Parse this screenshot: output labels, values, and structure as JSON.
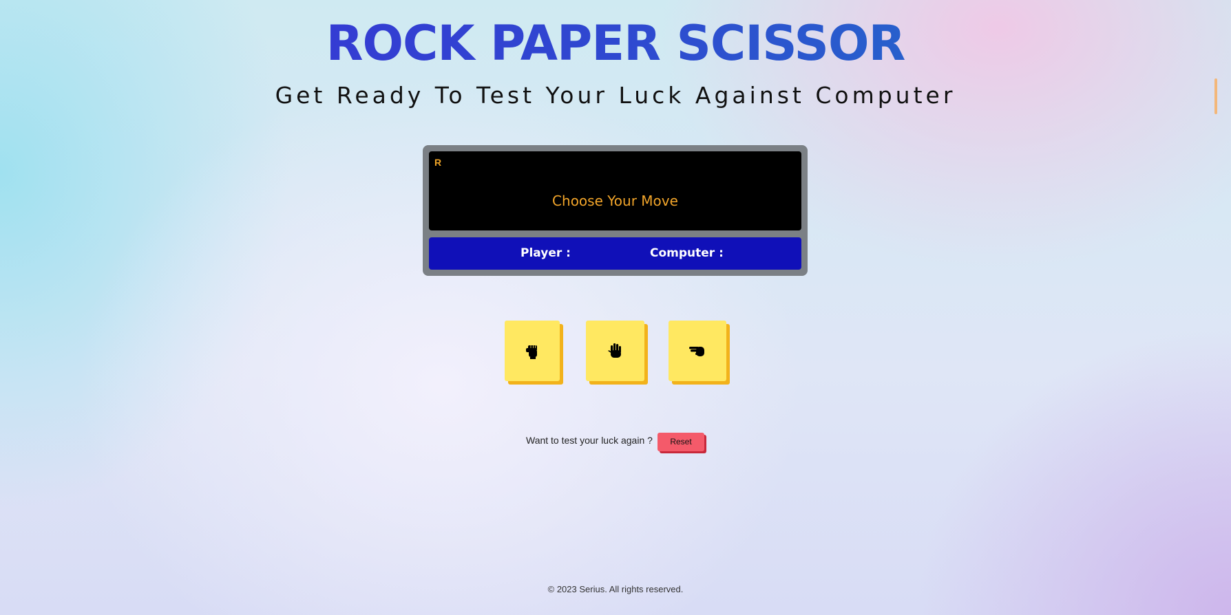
{
  "header": {
    "title": "ROCK PAPER SCISSOR",
    "subtitle": "Get Ready To Test Your Luck Against Computer"
  },
  "board": {
    "screen_tag": "R",
    "message": "Choose Your Move",
    "player_label": "Player :",
    "computer_label": "Computer :"
  },
  "moves": [
    {
      "name": "rock",
      "icon": "fist-icon"
    },
    {
      "name": "paper",
      "icon": "open-hand-icon"
    },
    {
      "name": "scissor",
      "icon": "scissors-hand-icon"
    }
  ],
  "reset_section": {
    "prompt": "Want to test your luck again ?",
    "button_label": "Reset"
  },
  "footer": {
    "copyright": "© 2023 Serius. All rights reserved."
  },
  "colors": {
    "title_gradient_start": "#3a2fd6",
    "title_gradient_end": "#1f7ac8",
    "screen_text": "#f2a52a",
    "scorebar": "#1010b8",
    "move_button": "#ffe861",
    "move_button_shadow": "#f2b21b",
    "reset_button": "#f45a6a"
  }
}
